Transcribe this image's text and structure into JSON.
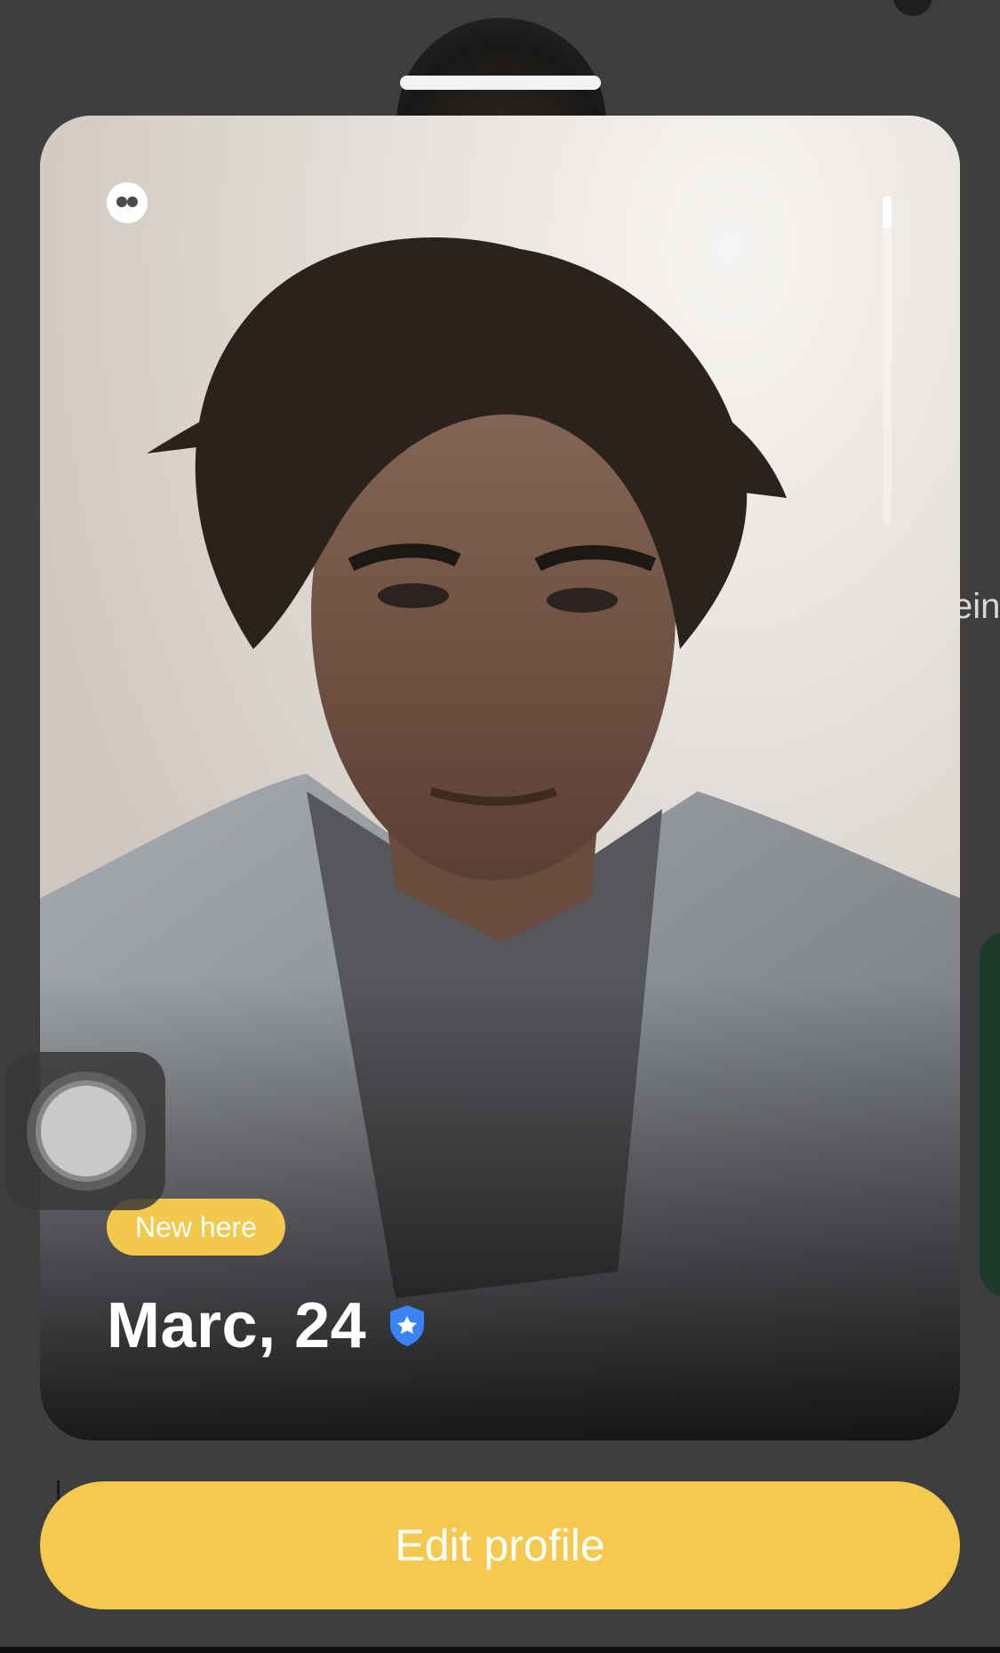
{
  "background": {
    "partial_text": "ein",
    "accent_green": "#1e3a2c"
  },
  "card": {
    "badge_label": "New here",
    "name_age": "Marc, 24",
    "photo_progress": 0.1,
    "badge_color": "#f2c94c",
    "verified_color": "#3b82f6",
    "icons": {
      "top_left": "quote-icon",
      "verified": "verified-shield-icon"
    }
  },
  "actions": {
    "edit_label": "Edit profile",
    "edit_color": "#f5c94e"
  }
}
